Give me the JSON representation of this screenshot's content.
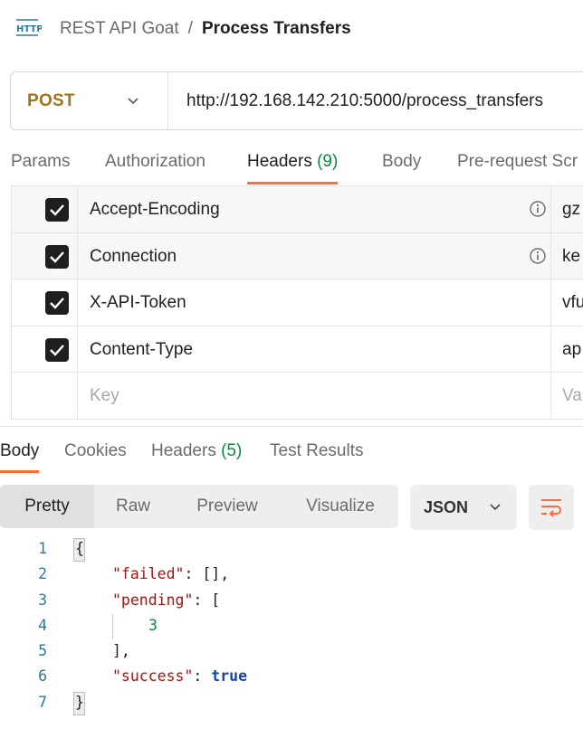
{
  "breadcrumb": {
    "parent": "REST API Goat",
    "separator": "/",
    "current": "Process Transfers",
    "icon": "http-icon",
    "icon_text": "HTTP"
  },
  "request": {
    "method": "POST",
    "url": "http://192.168.142.210:5000/process_transfers"
  },
  "request_tabs": {
    "params": "Params",
    "authorization": "Authorization",
    "headers_label": "Headers",
    "headers_count": "(9)",
    "body": "Body",
    "prerequest": "Pre-request Scr"
  },
  "headers": {
    "rows": [
      {
        "key": "Accept-Encoding",
        "value": "gz",
        "checked": true,
        "info": true
      },
      {
        "key": "Connection",
        "value": "ke",
        "checked": true,
        "info": true
      },
      {
        "key": "X-API-Token",
        "value": "vfu",
        "checked": true,
        "info": false
      },
      {
        "key": "Content-Type",
        "value": "ap",
        "checked": true,
        "info": false
      }
    ],
    "placeholder_key": "Key",
    "placeholder_value": "Va"
  },
  "response_tabs": {
    "body": "Body",
    "cookies": "Cookies",
    "headers_label": "Headers",
    "headers_count": "(5)",
    "test_results": "Test Results"
  },
  "view": {
    "pretty": "Pretty",
    "raw": "Raw",
    "preview": "Preview",
    "visualize": "Visualize",
    "format": "JSON"
  },
  "code": {
    "line_numbers": [
      "1",
      "2",
      "3",
      "4",
      "5",
      "6",
      "7"
    ],
    "open_brace": "{",
    "failed_key": "\"failed\"",
    "failed_rest": ": [],",
    "pending_key": "\"pending\"",
    "pending_rest": ": [",
    "pending_value": "3",
    "close_bracket": "],",
    "success_key": "\"success\"",
    "success_colon": ": ",
    "success_value": "true",
    "close_brace": "}"
  },
  "colors": {
    "accent": "#ff6c37",
    "method": "#a0741a",
    "count_green": "#0c8a3f"
  }
}
